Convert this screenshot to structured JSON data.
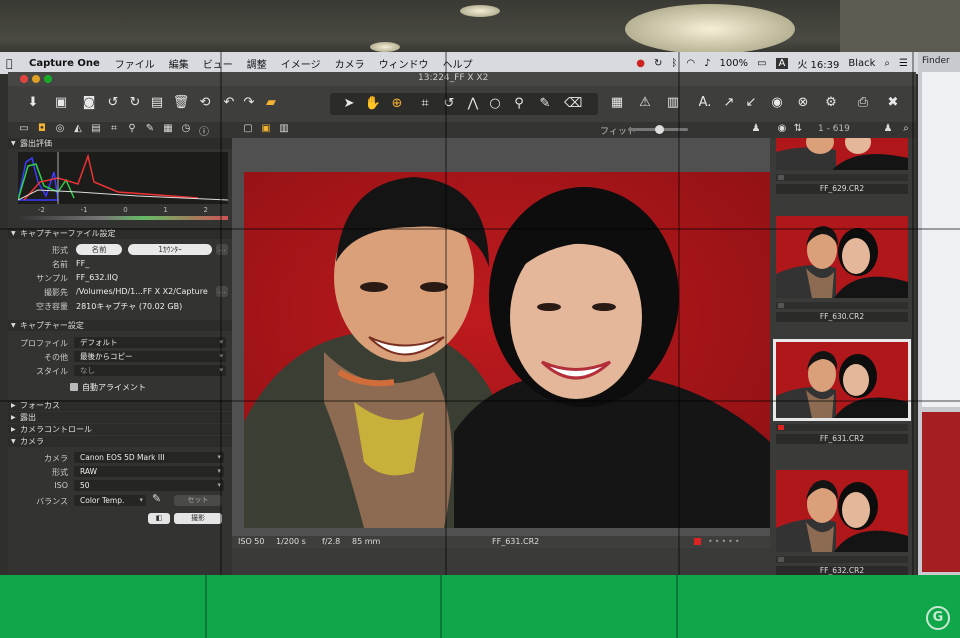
{
  "menubar": {
    "app_name": "Capture One",
    "items": [
      "ファイル",
      "編集",
      "ビュー",
      "調整",
      "イメージ",
      "カメラ",
      "ウィンドウ",
      "ヘルプ"
    ],
    "battery": "100%",
    "input_indicator": "A",
    "clock": "火 16:39",
    "user": "Black",
    "finder": "Finder"
  },
  "window": {
    "title": "13:224_FF X X2"
  },
  "viewer": {
    "fit_label": "フィット",
    "counter": "1 - 619",
    "info": {
      "iso": "ISO 50",
      "shutter": "1/200 s",
      "aperture": "f/2.8",
      "focal": "85 mm",
      "filename": "FF_631.CR2"
    }
  },
  "left_panel": {
    "histogram": {
      "title": "露出評価",
      "scale": [
        "-2",
        "-1",
        "0",
        "1",
        "2"
      ]
    },
    "capture_file": {
      "title": "キャプチャーファイル設定",
      "format_label": "形式",
      "format_opt1": "名前",
      "format_opt2": "1ｶｳﾝﾀｰ",
      "name_label": "名前",
      "name_value": "FF_",
      "sample_label": "サンプル",
      "sample_value": "FF_632.IIQ",
      "dest_label": "撮影先",
      "dest_value": "/Volumes/HD/1...FF X X2/Capture",
      "space_label": "空き容量",
      "space_value": "2810キャプチャ (70.02 GB)"
    },
    "capture_settings": {
      "title": "キャプチャー設定",
      "profile_label": "プロファイル",
      "profile_value": "デフォルト",
      "other_label": "その他",
      "other_value": "最後からコピー",
      "style_label": "スタイル",
      "style_value": "なし",
      "auto_align": "自動アライメント"
    },
    "collapsed_sections": [
      "フォーカス",
      "露出",
      "カメラコントロール"
    ],
    "camera": {
      "title": "カメラ",
      "camera_label": "カメラ",
      "camera_value": "Canon EOS 5D Mark III",
      "format_label": "形式",
      "format_value": "RAW",
      "iso_label": "ISO",
      "iso_value": "50",
      "balance_label": "バランス",
      "balance_value": "Color Temp.",
      "set_button": "セット",
      "shoot_button": "撮影"
    }
  },
  "browser": {
    "thumbnails": [
      {
        "filename": "FF_629.CR2"
      },
      {
        "filename": "FF_630.CR2"
      },
      {
        "filename": "FF_631.CR2"
      },
      {
        "filename": "FF_632.CR2"
      }
    ]
  },
  "colors": {
    "backdrop_red": "#b2161a",
    "stage_green": "#10a64a",
    "panel_dark": "#333331"
  }
}
